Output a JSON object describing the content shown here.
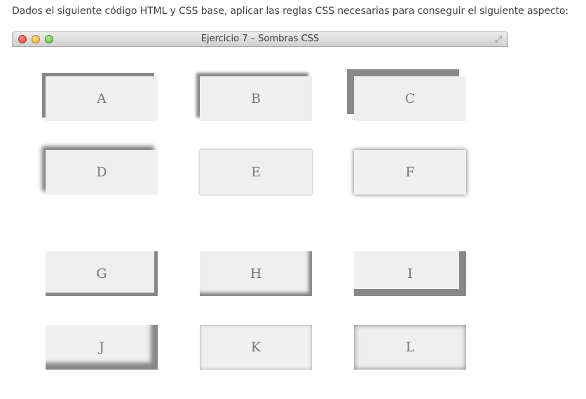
{
  "intro_text": "Dados el siguiente código HTML y CSS base, aplicar las reglas CSS necesarias para conseguir el siguiente aspecto:",
  "window": {
    "title": "Ejercicio 7 – Sombras CSS",
    "controls": [
      "close-button-red",
      "minimize-button-yellow",
      "zoom-button-green"
    ],
    "fullscreen_icon": "fullscreen-arrows-icon"
  },
  "boxes": {
    "A": "A",
    "B": "B",
    "C": "C",
    "D": "D",
    "E": "E",
    "F": "F",
    "G": "G",
    "H": "H",
    "I": "I",
    "J": "J",
    "K": "K",
    "L": "L"
  },
  "colors": {
    "box_background": "#efefef",
    "shadow": "#888888",
    "label": "#777777"
  }
}
